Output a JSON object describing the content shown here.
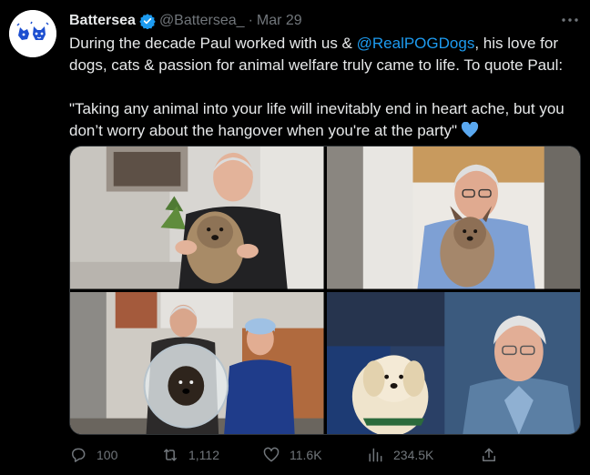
{
  "tweet": {
    "author_name": "Battersea",
    "author_handle": "@Battersea_",
    "separator": "·",
    "date": "Mar 29",
    "text_part1": "During the decade Paul worked with us & ",
    "mention": "@RealPOGDogs",
    "text_part2": ", his love for dogs, cats & passion for animal welfare truly came to life. To quote Paul:",
    "quote": "\"Taking any animal into your life will inevitably end in heart ache, but you don’t worry about the hangover when you're at the party\""
  },
  "photos": [
    {
      "icon": "photo-man-with-terrier"
    },
    {
      "icon": "photo-man-holding-terrier"
    },
    {
      "icon": "photo-man-vet-dog-cone"
    },
    {
      "icon": "photo-man-with-white-dog"
    }
  ],
  "actions": {
    "replies": "100",
    "retweets": "1,112",
    "likes": "11.6K",
    "views": "234.5K"
  },
  "colors": {
    "background": "#000000",
    "text": "#e7e9ea",
    "muted": "#71767b",
    "accent": "#1d9bf0"
  }
}
